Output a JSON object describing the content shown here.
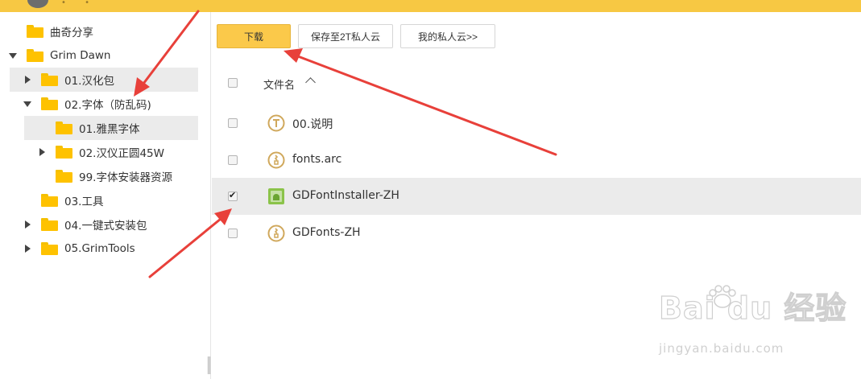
{
  "sidebar": {
    "items": [
      {
        "label": "曲奇分享"
      },
      {
        "label": "Grim Dawn"
      },
      {
        "label": "01.汉化包"
      },
      {
        "label": "02.字体（防乱码)"
      },
      {
        "label": "01.雅黑字体"
      },
      {
        "label": "02.汉仪正圆45W"
      },
      {
        "label": "99.字体安装器资源"
      },
      {
        "label": "03.工具"
      },
      {
        "label": "04.一键式安装包"
      },
      {
        "label": "05.GrimTools"
      }
    ]
  },
  "toolbar": {
    "download_label": "下载",
    "save_label": "保存至2T私人云",
    "mycloud_label": "我的私人云>>"
  },
  "list": {
    "header": "文件名",
    "files": [
      {
        "name": "00.说明",
        "icon": "text-file-icon",
        "checked": false
      },
      {
        "name": "fonts.arc",
        "icon": "archive-file-icon",
        "checked": false
      },
      {
        "name": "GDFontInstaller-ZH",
        "icon": "android-app-icon",
        "checked": true
      },
      {
        "name": "GDFonts-ZH",
        "icon": "archive-file-icon",
        "checked": false
      }
    ]
  },
  "watermark": {
    "big": "Bai du 经验",
    "small": "jingyan.baidu.com"
  },
  "colors": {
    "accent": "#f7c843",
    "annotation": "#e8403a",
    "folder": "#fec200",
    "selected_row": "#ebebeb"
  }
}
